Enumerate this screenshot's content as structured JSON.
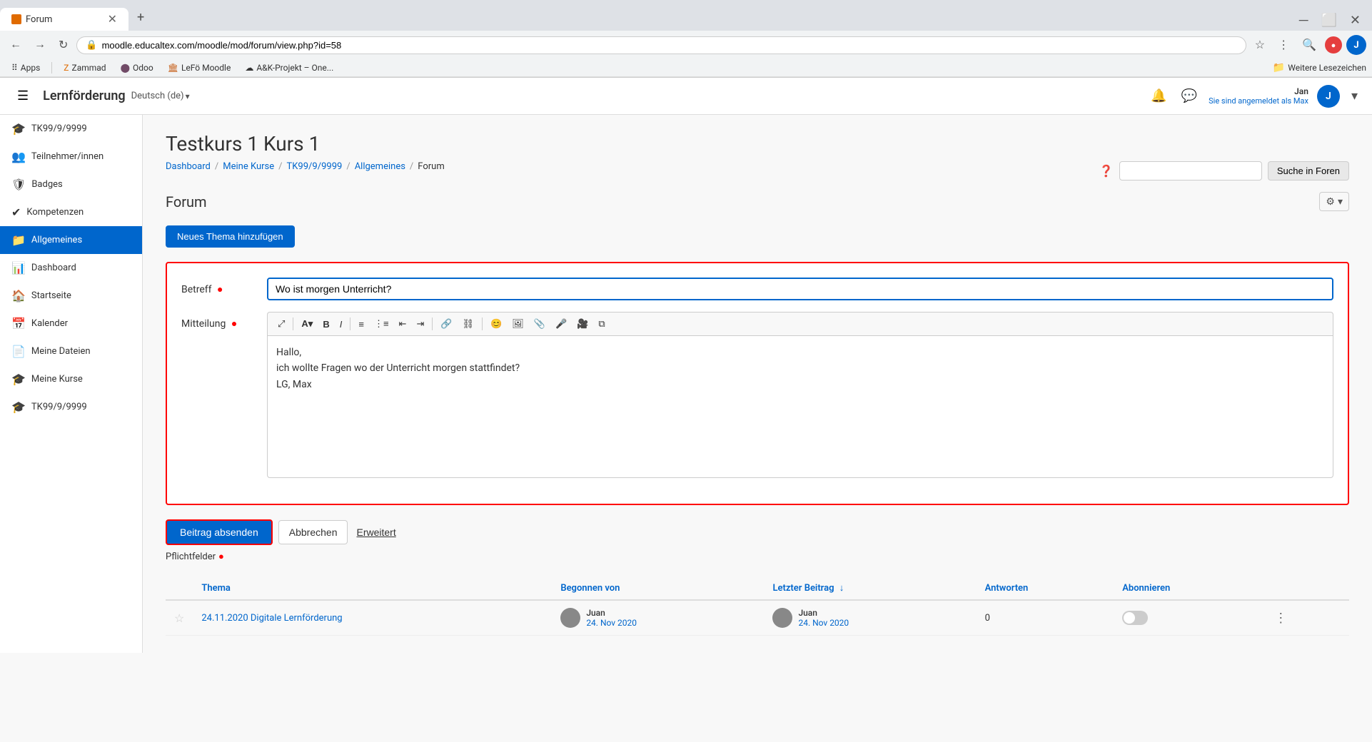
{
  "browser": {
    "tab_title": "Forum",
    "tab_icon_color": "#e06b00",
    "address": "moodle.educaltex.com/moodle/mod/forum/view.php?id=58",
    "bookmarks": [
      {
        "label": "Apps",
        "icon": "grid"
      },
      {
        "label": "Zammad",
        "icon": "z"
      },
      {
        "label": "Odoo",
        "icon": "o"
      },
      {
        "label": "LeFö Moodle",
        "icon": "m"
      },
      {
        "label": "A&K-Projekt – One...",
        "icon": "cloud"
      }
    ],
    "bookmark_right": "Weitere Lesezeichen"
  },
  "header": {
    "logo": "Lernförderung",
    "lang": "Deutsch (de)",
    "user_name": "Jan",
    "user_sub": "Sie sind angemeldet als Max",
    "avatar_letter": "J"
  },
  "sidebar": {
    "items": [
      {
        "id": "tk99",
        "label": "TK99/9/9999",
        "icon": "🎓"
      },
      {
        "id": "teilnehmer",
        "label": "Teilnehmer/innen",
        "icon": "👥"
      },
      {
        "id": "badges",
        "label": "Badges",
        "icon": "🛡"
      },
      {
        "id": "kompetenzen",
        "label": "Kompetenzen",
        "icon": "✔"
      },
      {
        "id": "allgemeines",
        "label": "Allgemeines",
        "icon": "📁",
        "active": true
      },
      {
        "id": "dashboard",
        "label": "Dashboard",
        "icon": "📊"
      },
      {
        "id": "startseite",
        "label": "Startseite",
        "icon": "🏠"
      },
      {
        "id": "kalender",
        "label": "Kalender",
        "icon": "📅"
      },
      {
        "id": "meine-dateien",
        "label": "Meine Dateien",
        "icon": "📄"
      },
      {
        "id": "meine-kurse",
        "label": "Meine Kurse",
        "icon": "🎓"
      },
      {
        "id": "tk99-2",
        "label": "TK99/9/9999",
        "icon": "🎓"
      }
    ]
  },
  "content": {
    "page_title": "Testkurs 1 Kurs 1",
    "breadcrumb": [
      {
        "label": "Dashboard",
        "link": true
      },
      {
        "label": "Meine Kurse",
        "link": true
      },
      {
        "label": "TK99/9/9999",
        "link": true
      },
      {
        "label": "Allgemeines",
        "link": true
      },
      {
        "label": "Forum",
        "link": false
      }
    ],
    "forum_title": "Forum",
    "search_placeholder": "",
    "search_btn_label": "Suche in Foren",
    "new_topic_btn": "Neues Thema hinzufügen",
    "form": {
      "betreff_label": "Betreff",
      "mitteilung_label": "Mitteilung",
      "betreff_value": "Wo ist morgen Unterricht?",
      "editor_content_line1": "Hallo,",
      "editor_content_line2": "ich wollte Fragen wo der Unterricht morgen stattfindet?",
      "editor_content_line3": "LG, Max",
      "submit_btn": "Beitrag absenden",
      "cancel_btn": "Abbrechen",
      "extend_btn": "Erweitert",
      "required_note": "Pflichtfelder"
    },
    "table": {
      "columns": [
        {
          "label": "Thema"
        },
        {
          "label": "Begonnen von"
        },
        {
          "label": "Letzter Beitrag",
          "sort": true
        },
        {
          "label": "Antworten"
        },
        {
          "label": "Abonnieren"
        }
      ],
      "rows": [
        {
          "star": "☆",
          "topic": "24.11.2020 Digitale Lernförderung",
          "started_by_name": "Juan",
          "started_by_date": "24. Nov 2020",
          "last_by_name": "Juan",
          "last_by_date": "24. Nov 2020",
          "answers": "0",
          "subscribed": false
        }
      ]
    }
  }
}
